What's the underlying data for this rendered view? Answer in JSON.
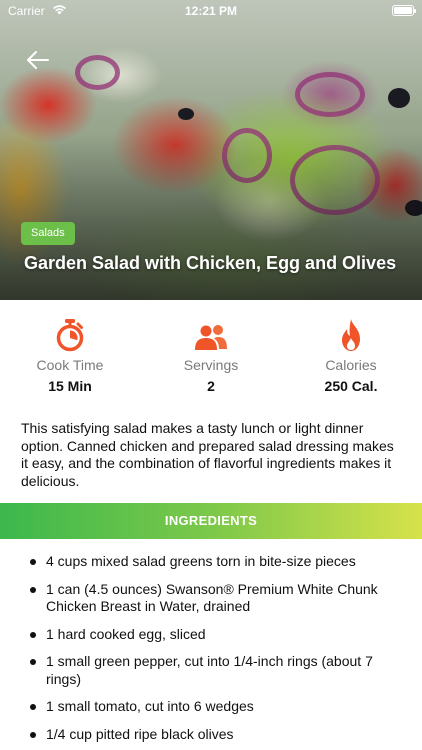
{
  "status_bar": {
    "carrier": "Carrier",
    "time": "12:21 PM"
  },
  "hero": {
    "category": "Salads",
    "title": "Garden Salad with Chicken, Egg and Olives"
  },
  "stats": [
    {
      "icon": "timer-icon",
      "label": "Cook Time",
      "value": "15 Min",
      "color": "#f0552a"
    },
    {
      "icon": "people-icon",
      "label": "Servings",
      "value": "2",
      "color": "#f0552a"
    },
    {
      "icon": "flame-icon",
      "label": "Calories",
      "value": "250 Cal.",
      "color": "#f0552a"
    }
  ],
  "description": "This satisfying salad makes a tasty lunch or light dinner option. Canned chicken and prepared salad dressing makes it easy, and the combination of flavorful ingredients makes it delicious.",
  "ingredients": {
    "heading": "INGREDIENTS",
    "items": [
      "4 cups mixed salad greens torn in bite-size pieces",
      "1 can (4.5 ounces) Swanson® Premium White Chunk Chicken Breast in Water, drained",
      "1 hard cooked egg, sliced",
      "1 small green pepper, cut into 1/4-inch rings (about 7 rings)",
      "1 small tomato, cut into 6 wedges",
      "1/4 cup pitted ripe black olives"
    ]
  },
  "colors": {
    "accent": "#f0552a",
    "badge": "#6cc04a",
    "bar_start": "#3cb84c",
    "bar_end": "#d6e24a"
  }
}
